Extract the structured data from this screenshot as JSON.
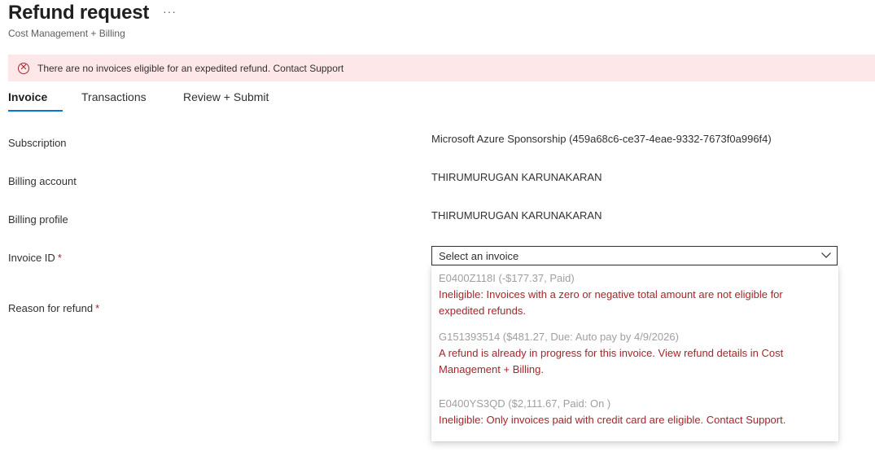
{
  "page": {
    "title": "Refund request",
    "more_label": "···",
    "subtitle": "Cost Management + Billing"
  },
  "banner": {
    "icon": "error-circle-icon",
    "text": "There are no invoices eligible for an expedited refund. Contact Support",
    "color": "#a4262c",
    "background": "#fde7e9"
  },
  "tabs": [
    {
      "label": "Invoice",
      "active": true
    },
    {
      "label": "Transactions",
      "active": false
    },
    {
      "label": "Review + Submit",
      "active": false
    }
  ],
  "form": {
    "subscription": {
      "label": "Subscription",
      "value": "Microsoft Azure Sponsorship (459a68c6-ce37-4eae-9332-7673f0a996f4)"
    },
    "billing_account": {
      "label": "Billing account",
      "value": "THIRUMURUGAN KARUNAKARAN"
    },
    "billing_profile": {
      "label": "Billing profile",
      "value": "THIRUMURUGAN KARUNAKARAN"
    },
    "invoice_id": {
      "label": "Invoice ID",
      "required_mark": "*",
      "placeholder": "Select an invoice"
    },
    "reason": {
      "label": "Reason for refund",
      "required_mark": "*"
    }
  },
  "invoice_options": [
    {
      "title": "E0400Z118I (-$177.37, Paid)",
      "message": "Ineligible: Invoices with a zero or negative total amount are not eligible for expedited refunds."
    },
    {
      "title": "G151393514 ($481.27, Due: Auto pay by 4/9/2026)",
      "message": "A refund is already in progress for this invoice. View refund details in Cost Management + Billing."
    },
    {
      "title": "E0400YS3QD ($2,111.67, Paid: On )",
      "message": "Ineligible: Only invoices paid with credit card are eligible. Contact Support."
    }
  ],
  "colors": {
    "accent": "#0078d4",
    "error": "#a4262c",
    "disabled_text": "#a19f9d"
  }
}
